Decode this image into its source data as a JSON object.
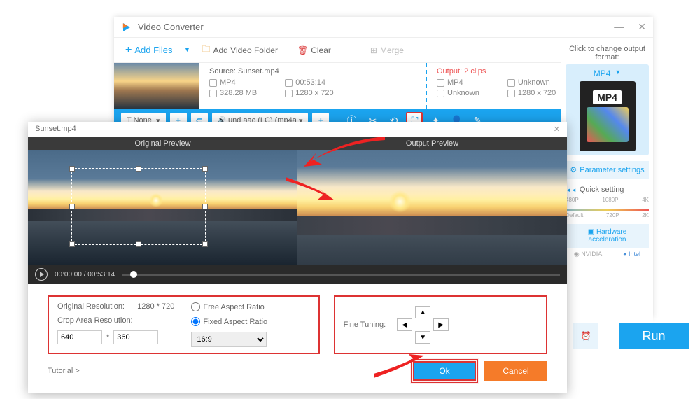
{
  "window": {
    "title": "Video Converter"
  },
  "toolbar": {
    "add_files": "Add Files",
    "add_folder": "Add Video Folder",
    "clear": "Clear",
    "merge": "Merge"
  },
  "item": {
    "source_label": "Source:",
    "source_file": "Sunset.mp4",
    "src_format": "MP4",
    "src_duration": "00:53:14",
    "src_size": "328.28 MB",
    "src_res": "1280 x 720",
    "output_label": "Output:",
    "output_count": "2 clips",
    "out_format": "MP4",
    "out_time": "Unknown",
    "out_size": "Unknown",
    "out_res": "1280 x 720"
  },
  "bluebar": {
    "track_none": "T   None",
    "audio_track": "und aac (LC) (mp4a"
  },
  "side": {
    "change_format": "Click to change output format:",
    "format": "MP4",
    "param_settings": "Parameter settings",
    "quick_setting": "Quick setting",
    "presets": [
      "Default",
      "480P",
      "720P",
      "1080P",
      "2K",
      "4K"
    ],
    "hw_accel": "Hardware acceleration",
    "nvidia": "NVIDIA",
    "intel": "Intel"
  },
  "run": "Run",
  "crop": {
    "title": "Sunset.mp4",
    "original_preview": "Original Preview",
    "output_preview": "Output Preview",
    "time_current": "00:00:00",
    "time_total": "00:53:14",
    "orig_res_label": "Original Resolution:",
    "orig_res": "1280 * 720",
    "crop_res_label": "Crop Area Resolution:",
    "crop_w": "640",
    "crop_h": "360",
    "free_ar": "Free Aspect Ratio",
    "fixed_ar": "Fixed Aspect Ratio",
    "ar_value": "16:9",
    "fine_tuning": "Fine Tuning:",
    "tutorial": "Tutorial >",
    "ok": "Ok",
    "cancel": "Cancel"
  }
}
